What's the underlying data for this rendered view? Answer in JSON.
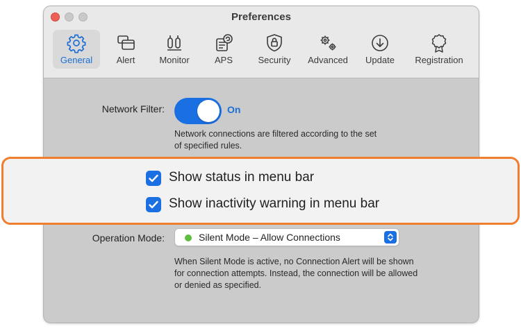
{
  "window": {
    "title": "Preferences"
  },
  "toolbar": {
    "items": [
      {
        "label": "General",
        "icon": "gear-icon",
        "active": true
      },
      {
        "label": "Alert",
        "icon": "alert-windows-icon",
        "active": false
      },
      {
        "label": "Monitor",
        "icon": "monitor-gauges-icon",
        "active": false
      },
      {
        "label": "APS",
        "icon": "aps-document-icon",
        "active": false
      },
      {
        "label": "Security",
        "icon": "lock-shield-icon",
        "active": false
      },
      {
        "label": "Advanced",
        "icon": "gears-icon",
        "active": false
      },
      {
        "label": "Update",
        "icon": "download-arrow-icon",
        "active": false
      },
      {
        "label": "Registration",
        "icon": "badge-ribbon-icon",
        "active": false
      }
    ]
  },
  "network_filter": {
    "label": "Network Filter:",
    "state": "On",
    "description": "Network connections are filtered according to the set of specified rules."
  },
  "options": [
    {
      "label": "Show status in menu bar",
      "checked": true
    },
    {
      "label": "Show inactivity warning in menu bar",
      "checked": true
    }
  ],
  "operation_mode": {
    "label": "Operation Mode:",
    "value": "Silent Mode – Allow Connections",
    "status_color": "#5dbf3e",
    "description": "When Silent Mode is active, no Connection Alert will be shown for connection attempts. Instead, the connection will be allowed or denied as specified."
  },
  "colors": {
    "accent": "#1a6fe3",
    "highlight_border": "#f07e2e"
  }
}
